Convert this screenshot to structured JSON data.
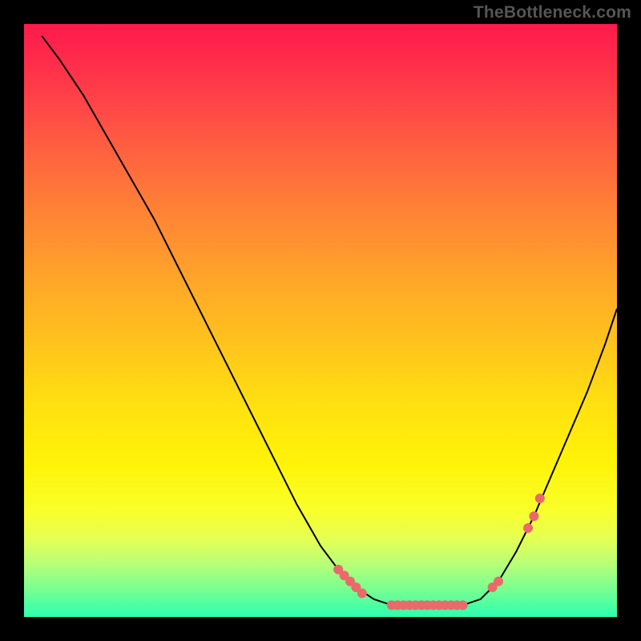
{
  "watermark": "TheBottleneck.com",
  "colors": {
    "background": "#000000",
    "curve": "#000000",
    "dot": "#e96a6a",
    "gradient_top": "#ff1a4d",
    "gradient_bottom": "#2dffb0"
  },
  "chart_data": {
    "type": "line",
    "title": "",
    "xlabel": "",
    "ylabel": "",
    "xlim": [
      0,
      100
    ],
    "ylim": [
      0,
      100
    ],
    "grid": false,
    "curve_points": [
      {
        "x": 3,
        "y": 98
      },
      {
        "x": 6,
        "y": 94
      },
      {
        "x": 10,
        "y": 88
      },
      {
        "x": 14,
        "y": 81
      },
      {
        "x": 18,
        "y": 74
      },
      {
        "x": 22,
        "y": 67
      },
      {
        "x": 26,
        "y": 59
      },
      {
        "x": 30,
        "y": 51
      },
      {
        "x": 34,
        "y": 43
      },
      {
        "x": 38,
        "y": 35
      },
      {
        "x": 42,
        "y": 27
      },
      {
        "x": 46,
        "y": 19
      },
      {
        "x": 50,
        "y": 12
      },
      {
        "x": 53,
        "y": 8
      },
      {
        "x": 56,
        "y": 5
      },
      {
        "x": 59,
        "y": 3
      },
      {
        "x": 62,
        "y": 2
      },
      {
        "x": 65,
        "y": 2
      },
      {
        "x": 68,
        "y": 2
      },
      {
        "x": 71,
        "y": 2
      },
      {
        "x": 74,
        "y": 2
      },
      {
        "x": 77,
        "y": 3
      },
      {
        "x": 80,
        "y": 6
      },
      {
        "x": 83,
        "y": 11
      },
      {
        "x": 86,
        "y": 17
      },
      {
        "x": 89,
        "y": 24
      },
      {
        "x": 92,
        "y": 31
      },
      {
        "x": 95,
        "y": 38
      },
      {
        "x": 98,
        "y": 46
      },
      {
        "x": 100,
        "y": 52
      }
    ],
    "dots": [
      {
        "x": 53,
        "y": 8
      },
      {
        "x": 54,
        "y": 7
      },
      {
        "x": 55,
        "y": 6
      },
      {
        "x": 56,
        "y": 5
      },
      {
        "x": 57,
        "y": 4
      },
      {
        "x": 62,
        "y": 2
      },
      {
        "x": 63,
        "y": 2
      },
      {
        "x": 64,
        "y": 2
      },
      {
        "x": 65,
        "y": 2
      },
      {
        "x": 66,
        "y": 2
      },
      {
        "x": 67,
        "y": 2
      },
      {
        "x": 68,
        "y": 2
      },
      {
        "x": 69,
        "y": 2
      },
      {
        "x": 70,
        "y": 2
      },
      {
        "x": 71,
        "y": 2
      },
      {
        "x": 72,
        "y": 2
      },
      {
        "x": 73,
        "y": 2
      },
      {
        "x": 74,
        "y": 2
      },
      {
        "x": 79,
        "y": 5
      },
      {
        "x": 80,
        "y": 6
      },
      {
        "x": 85,
        "y": 15
      },
      {
        "x": 86,
        "y": 17
      },
      {
        "x": 87,
        "y": 20
      }
    ]
  }
}
